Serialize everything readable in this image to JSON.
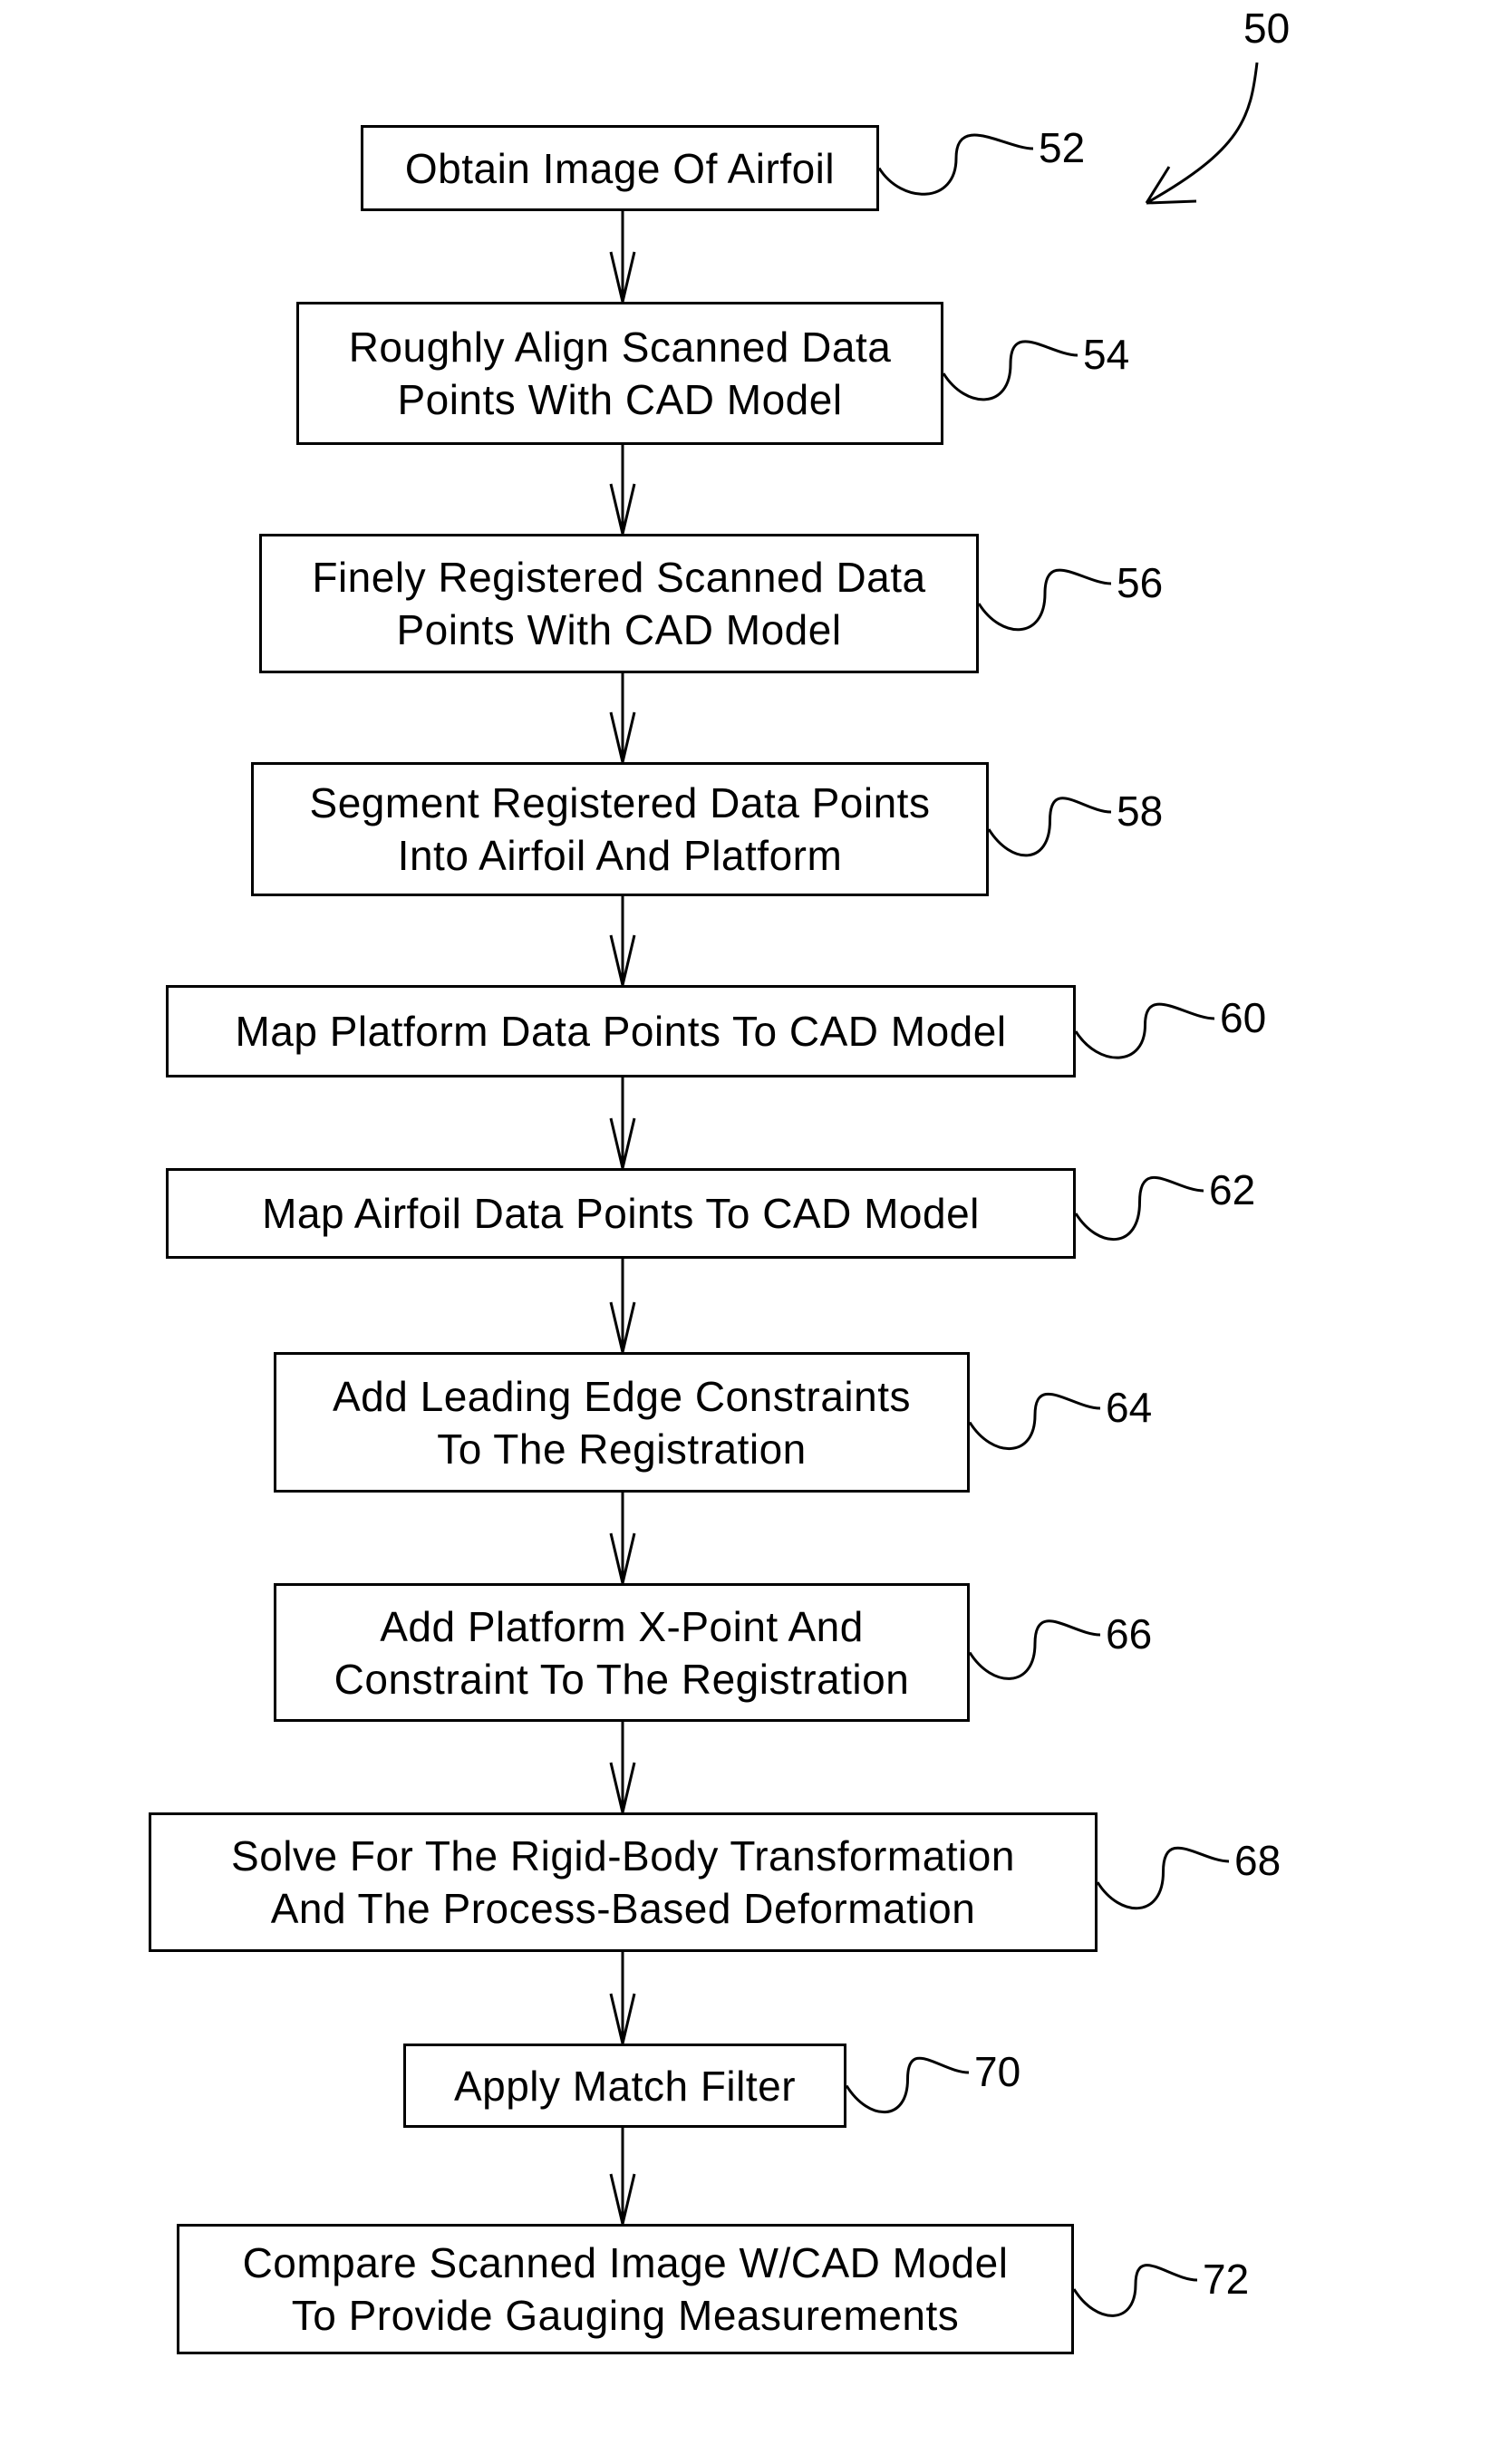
{
  "figure": {
    "reference_number": "50",
    "steps": [
      {
        "ref": "52",
        "lines": [
          "Obtain Image Of Airfoil"
        ]
      },
      {
        "ref": "54",
        "lines": [
          "Roughly Align Scanned Data",
          "Points With CAD Model"
        ]
      },
      {
        "ref": "56",
        "lines": [
          "Finely Registered Scanned Data",
          "Points With CAD Model"
        ]
      },
      {
        "ref": "58",
        "lines": [
          "Segment Registered Data Points",
          "Into Airfoil And Platform"
        ]
      },
      {
        "ref": "60",
        "lines": [
          "Map Platform Data Points To CAD Model"
        ]
      },
      {
        "ref": "62",
        "lines": [
          "Map Airfoil Data Points To CAD Model"
        ]
      },
      {
        "ref": "64",
        "lines": [
          "Add Leading Edge Constraints",
          "To The Registration"
        ]
      },
      {
        "ref": "66",
        "lines": [
          "Add Platform X-Point And",
          "Constraint To The Registration"
        ]
      },
      {
        "ref": "68",
        "lines": [
          "Solve For The Rigid-Body Transformation",
          "And The Process-Based Deformation"
        ]
      },
      {
        "ref": "70",
        "lines": [
          "Apply Match Filter"
        ]
      },
      {
        "ref": "72",
        "lines": [
          "Compare Scanned Image W/CAD Model",
          "To Provide Gauging Measurements"
        ]
      }
    ]
  }
}
